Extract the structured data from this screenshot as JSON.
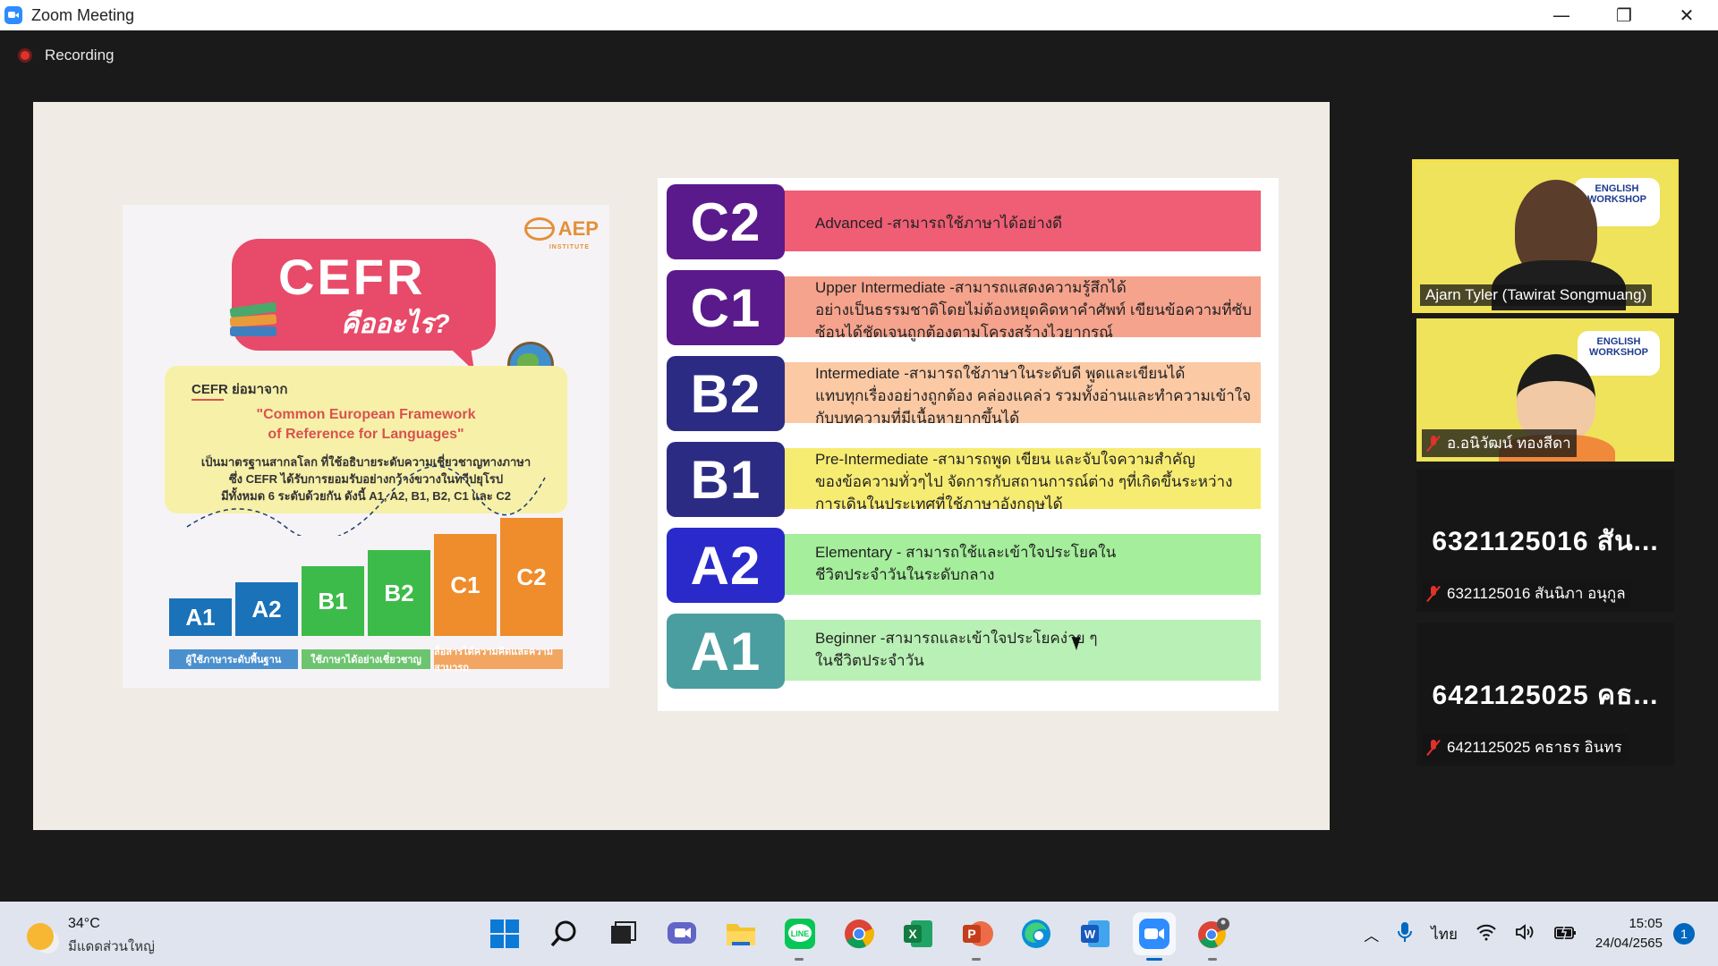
{
  "window": {
    "title": "Zoom Meeting",
    "minimize": "—",
    "restore": "❐",
    "close": "✕"
  },
  "meeting": {
    "recording_label": "Recording"
  },
  "slide": {
    "card": {
      "logo": "AEP",
      "logo_sub": "INSTITUTE",
      "bubble_title": "CEFR",
      "bubble_subtitle": "คืออะไร?",
      "abbr_label": "CEFR ย่อมาจาก",
      "full_name_line1": "\"Common European Framework",
      "full_name_line2": "of Reference for Languages\"",
      "desc_line1": "เป็นมาตรฐานสากลโลก ที่ใช้อธิบายระดับความเชี่ยวชาญทางภาษา",
      "desc_line2": "ซึ่ง CEFR ได้รับการยอมรับอย่างกว้างขวางในทวีปยุโรป",
      "desc_line3": "มีทั้งหมด 6 ระดับด้วยกัน ดังนี้ A1, A2, B1, B2, C1 และ C2",
      "steps": [
        "A1",
        "A2",
        "B1",
        "B2",
        "C1",
        "C2"
      ],
      "captions": [
        "ผู้ใช้ภาษาระดับพื้นฐาน",
        "ใช้ภาษาได้อย่างเชี่ยวชาญ",
        "สื่อสารได้ความคิดและความสามารถ"
      ]
    },
    "levels": [
      {
        "code": "C2",
        "main": "Advanced -สามารถใช้ภาษาได้อย่างดี",
        "sub": "",
        "badge": "#5b1a8c",
        "bar": "#ef5e74"
      },
      {
        "code": "C1",
        "main": "Upper Intermediate -สามารถแสดงความรู้สึกได้",
        "sub": "อย่างเป็นธรรมชาติโดยไม่ต้องหยุดคิดหาคำศัพท์ เขียนข้อความที่ซับซ้อนได้ชัดเจนถูกต้องตามโครงสร้างไวยากรณ์",
        "badge": "#5b1a8c",
        "bar": "#f6a38d"
      },
      {
        "code": "B2",
        "main": "Intermediate -สามารถใช้ภาษาในระดับดี พูดและเขียนได้",
        "sub": "แทบทุกเรื่องอย่างถูกต้อง คล่องแคล่ว รวมทั้งอ่านและทำความเข้าใจกับบทความที่มีเนื้อหายากขึ้นได้",
        "badge": "#2c2b84",
        "bar": "#fbc9a4"
      },
      {
        "code": "B1",
        "main": "Pre-Intermediate -สามารถพูด เขียน และจับใจความสำคัญ",
        "sub": "ของข้อความทั่วๆไป จัดการกับสถานการณ์ต่าง ๆที่เกิดขึ้นระหว่างการเดินในประเทศที่ใช้ภาษาอังกฤษได้",
        "badge": "#2c2b84",
        "bar": "#f7ec72"
      },
      {
        "code": "A2",
        "main": "Elementary - สามารถใช้และเข้าใจประโยคใน",
        "sub": "ชีวิตประจำวันในระดับกลาง",
        "badge": "#2a2acb",
        "bar": "#a5ee9c"
      },
      {
        "code": "A1",
        "main": "Beginner -สามารถและเข้าใจประโยคง่าย ๆ",
        "sub": "ในชีวิตประจำวัน",
        "badge": "#4a9ea0",
        "bar": "#b9f0b5"
      }
    ]
  },
  "participants": [
    {
      "name": "Ajarn Tyler (Tawirat Songmuang)",
      "type": "video",
      "muted": false,
      "banner": "Art Ed. BSRU. ENGLISH WORKSHOP"
    },
    {
      "name": "อ.อนิวัฒน์ ทองสีดา",
      "type": "video",
      "muted": true,
      "banner": "Art Ed. BSRU. ENGLISH WORKSHOP"
    },
    {
      "name": "6321125016 สันนิภา อนุกูล",
      "big": "6321125016 สัน...",
      "type": "name",
      "muted": true
    },
    {
      "name": "6421125025 คธาธร อินทร",
      "big": "6421125025 คธ...",
      "type": "name",
      "muted": true
    }
  ],
  "taskbar": {
    "temperature": "34°C",
    "weather_text": "มีแดดส่วนใหญ่",
    "language": "ไทย",
    "time": "15:05",
    "date": "24/04/2565",
    "notification_count": "1",
    "apps": [
      "start-icon",
      "search-icon",
      "task-view-icon",
      "teams-chat-icon",
      "file-explorer-icon",
      "line-app-icon",
      "chrome-icon",
      "excel-icon",
      "powerpoint-icon",
      "edge-icon",
      "word-icon",
      "zoom-icon",
      "chrome-profile-icon"
    ]
  }
}
